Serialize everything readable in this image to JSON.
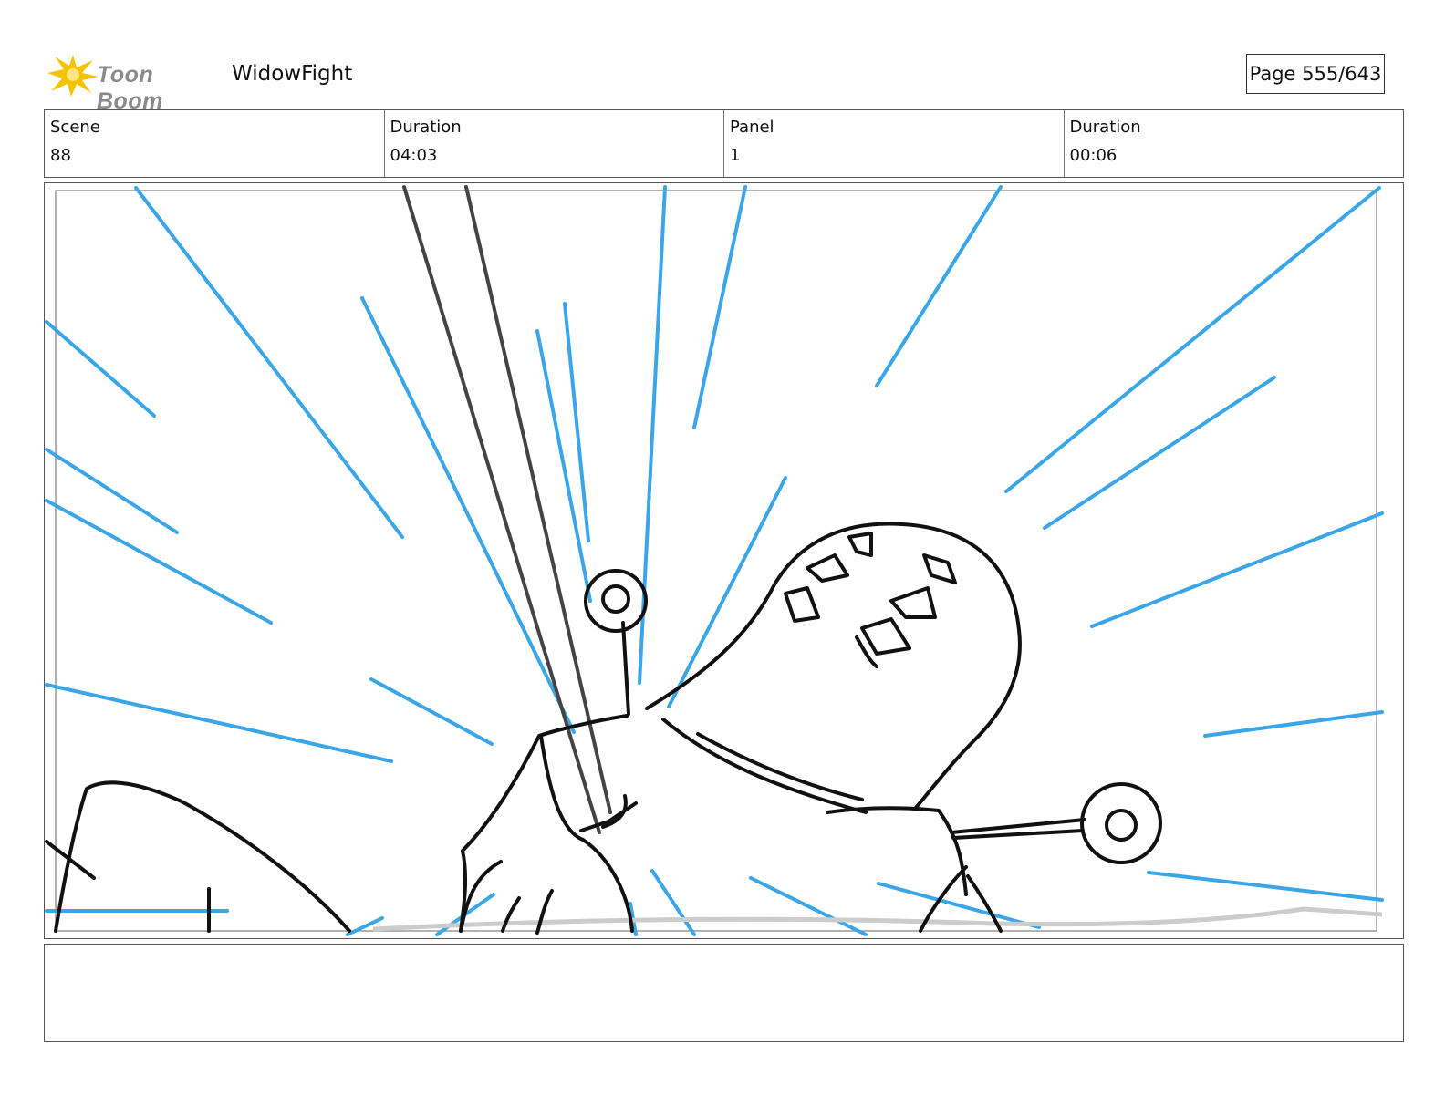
{
  "header": {
    "logo_text": "Toon Boom",
    "project_title": "WidowFight",
    "page_label": "Page 555/643"
  },
  "info": {
    "scene_label": "Scene",
    "scene_value": "88",
    "scene_duration_label": "Duration",
    "scene_duration_value": "04:03",
    "panel_label": "Panel",
    "panel_value": "1",
    "panel_duration_label": "Duration",
    "panel_duration_value": "00:06"
  },
  "colors": {
    "speed_lines": "#3aa6e8",
    "ink": "#111111",
    "logo_star": "#f5c400"
  },
  "notes": ""
}
